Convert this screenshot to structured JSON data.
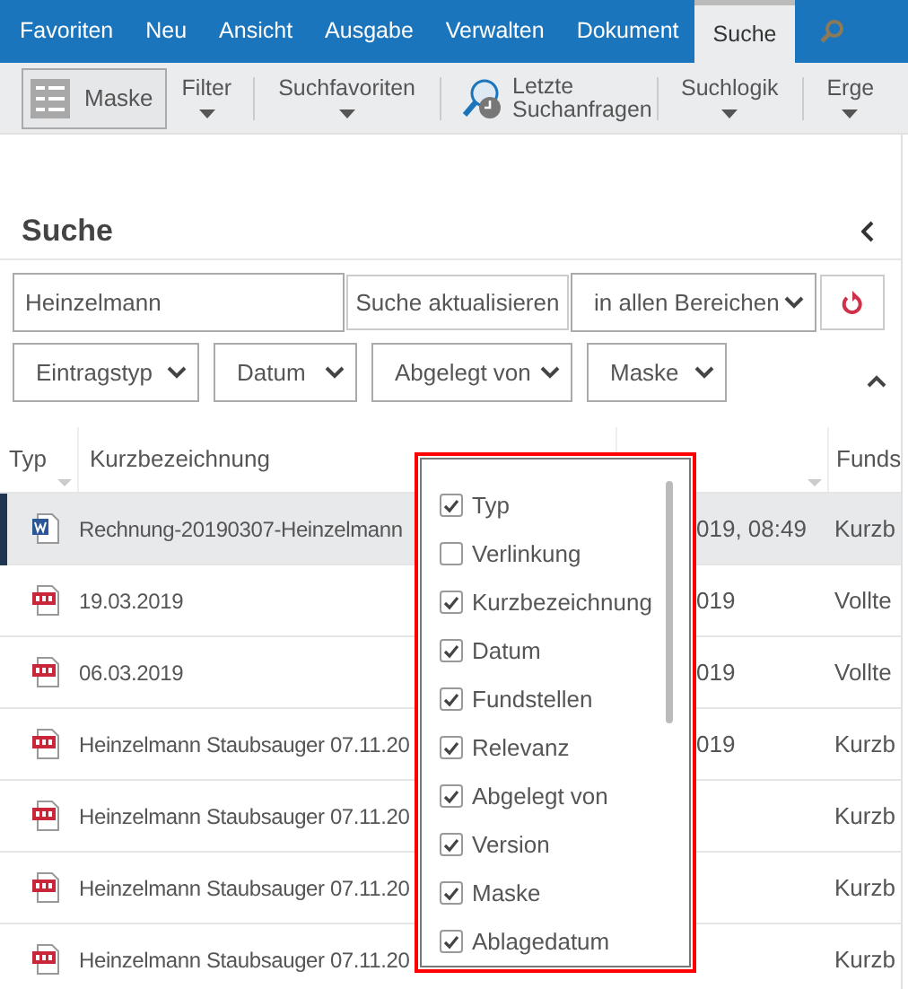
{
  "ribbon_tabs": [
    {
      "label": "Favoriten",
      "selected": false
    },
    {
      "label": "Neu",
      "selected": false
    },
    {
      "label": "Ansicht",
      "selected": false
    },
    {
      "label": "Ausgabe",
      "selected": false
    },
    {
      "label": "Verwalten",
      "selected": false
    },
    {
      "label": "Dokument",
      "selected": false
    },
    {
      "label": "Suche",
      "selected": true
    }
  ],
  "toolbar": [
    {
      "kind": "mask",
      "label": "Maske"
    },
    {
      "kind": "dropdown",
      "label": "Filter"
    },
    {
      "kind": "dropdown",
      "label": "Suchfavoriten"
    },
    {
      "kind": "recent",
      "label": "Letzte Suchanfragen"
    },
    {
      "kind": "dropdown",
      "label": "Suchlogik"
    },
    {
      "kind": "dropdown",
      "label": "Erge"
    }
  ],
  "panel": {
    "title": "Suche"
  },
  "search": {
    "value": "Heinzelmann",
    "update_button": "Suche aktualisieren",
    "scope": "in allen Bereichen"
  },
  "filters": [
    "Eintragstyp",
    "Datum",
    "Abgelegt von",
    "Maske"
  ],
  "table": {
    "columns": [
      "Typ",
      "Kurzbezeichnung",
      "Funds"
    ],
    "rows": [
      {
        "kind": "word",
        "name": "Rechnung-20190307-Heinzelmann",
        "column_3": "019, 08:49",
        "column_4": "Kurzb",
        "selected": true
      },
      {
        "kind": "pdf",
        "name": "19.03.2019",
        "column_3": "019",
        "column_4": "Vollte",
        "selected": false
      },
      {
        "kind": "pdf",
        "name": "06.03.2019",
        "column_3": "019",
        "column_4": "Vollte",
        "selected": false
      },
      {
        "kind": "pdf",
        "name": "Heinzelmann Staubsauger 07.11.20",
        "column_3": "019",
        "column_4": "Kurzb",
        "selected": false
      },
      {
        "kind": "pdf",
        "name": "Heinzelmann Staubsauger 07.11.20",
        "column_4": "Kurzb",
        "selected": false
      },
      {
        "kind": "pdf",
        "name": "Heinzelmann Staubsauger 07.11.20",
        "column_4": "Kurzb",
        "selected": false
      },
      {
        "kind": "pdf",
        "name": "Heinzelmann Staubsauger 07.11.20",
        "column_4": "Kurzb",
        "selected": false
      }
    ]
  },
  "column_chooser": {
    "items": [
      {
        "label": "Typ",
        "checked": true
      },
      {
        "label": "Verlinkung",
        "checked": false
      },
      {
        "label": "Kurzbezeichnung",
        "checked": true
      },
      {
        "label": "Datum",
        "checked": true
      },
      {
        "label": "Fundstellen",
        "checked": true
      },
      {
        "label": "Relevanz",
        "checked": true
      },
      {
        "label": "Abgelegt von",
        "checked": true
      },
      {
        "label": "Version",
        "checked": true
      },
      {
        "label": "Maske",
        "checked": true
      },
      {
        "label": "Ablagedatum",
        "checked": true
      }
    ]
  }
}
